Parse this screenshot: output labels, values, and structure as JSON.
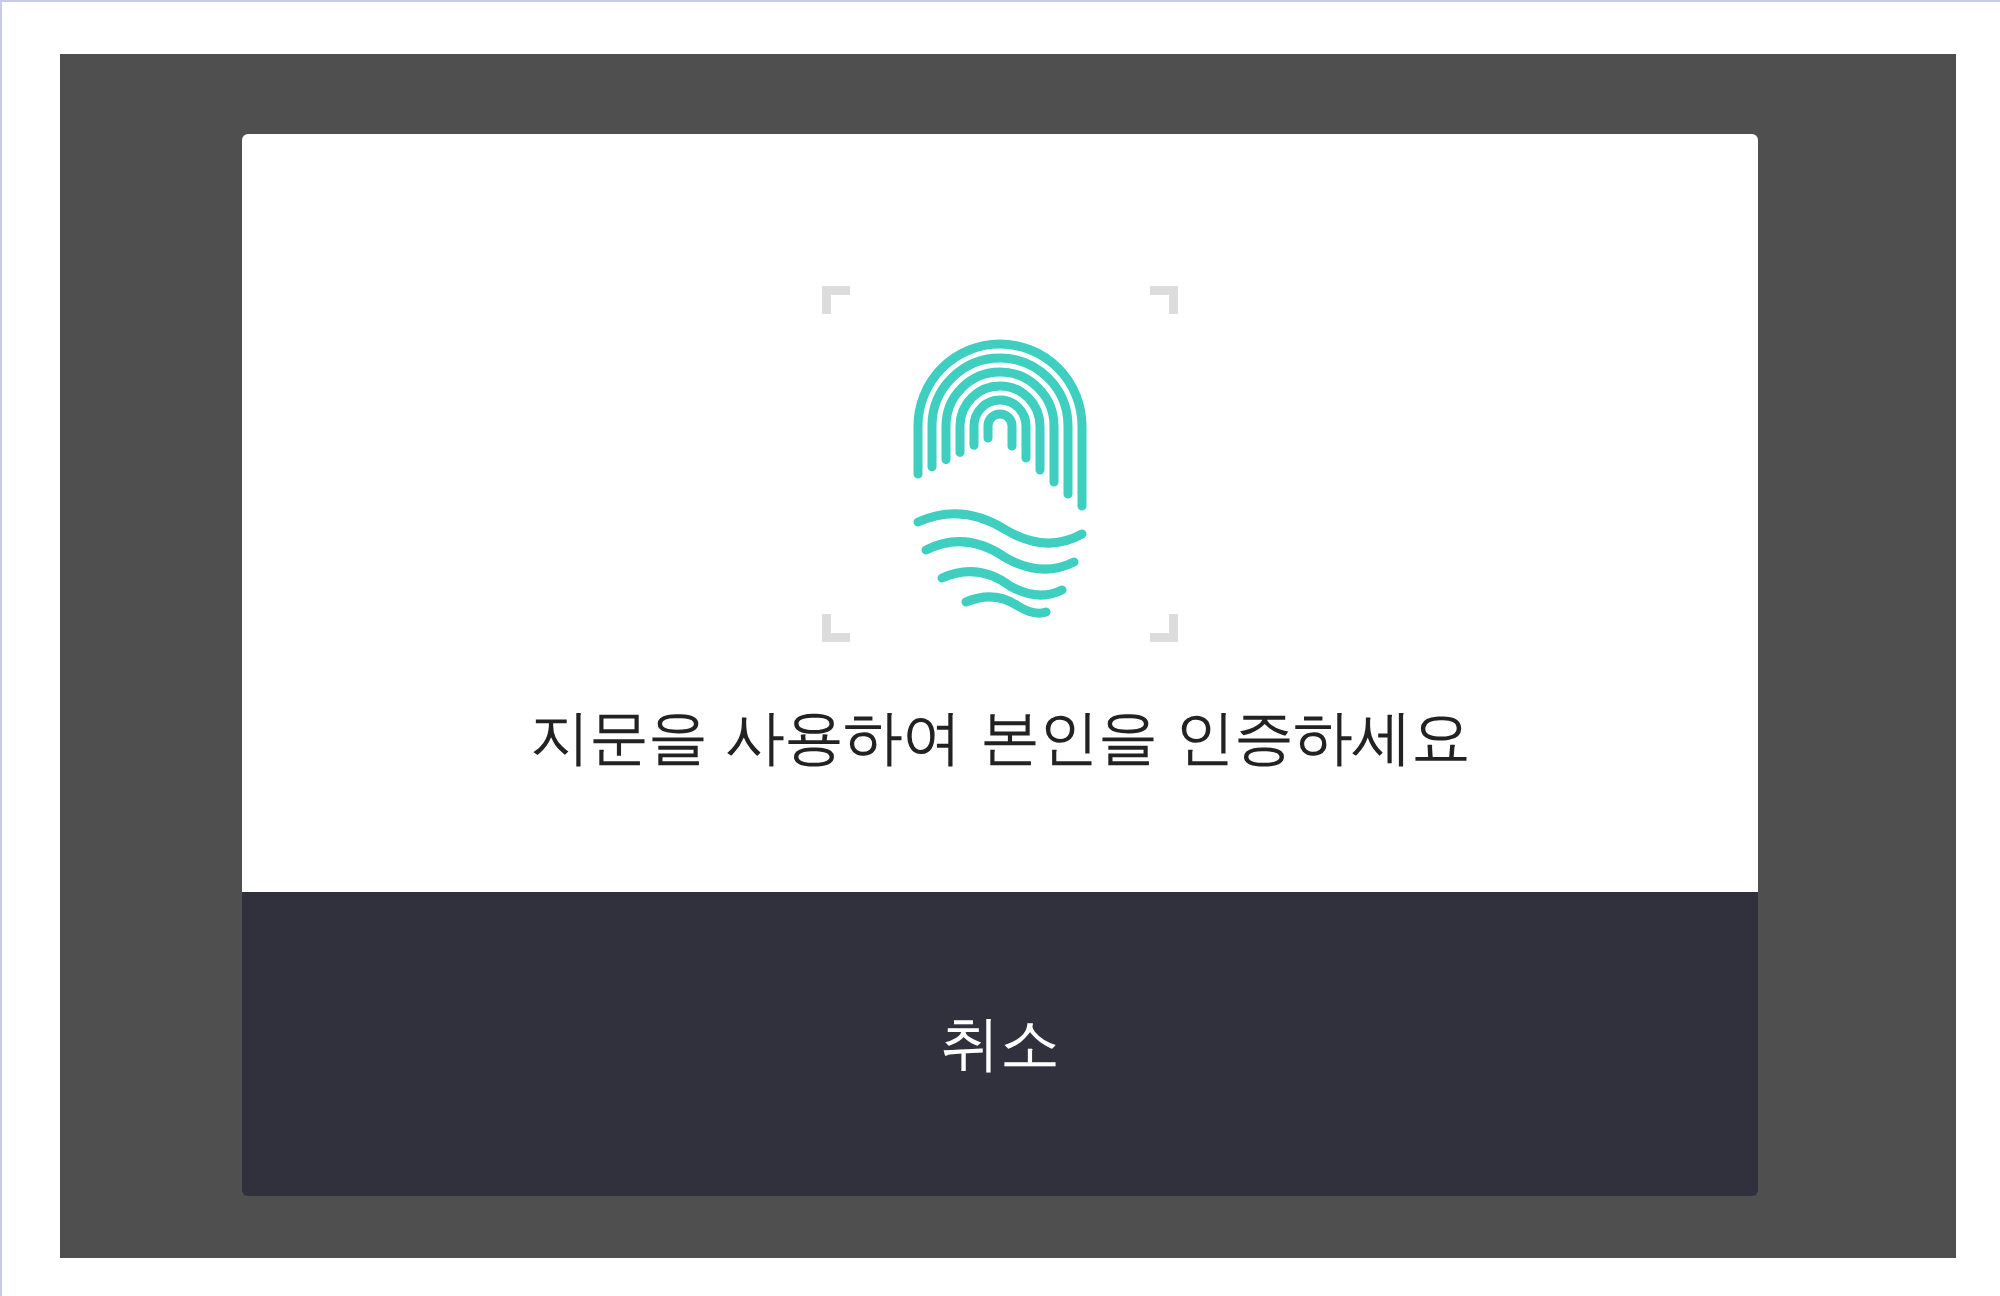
{
  "dialog": {
    "message": "지문을 사용하여 본인을 인증하세요",
    "cancel_button": "취소"
  }
}
